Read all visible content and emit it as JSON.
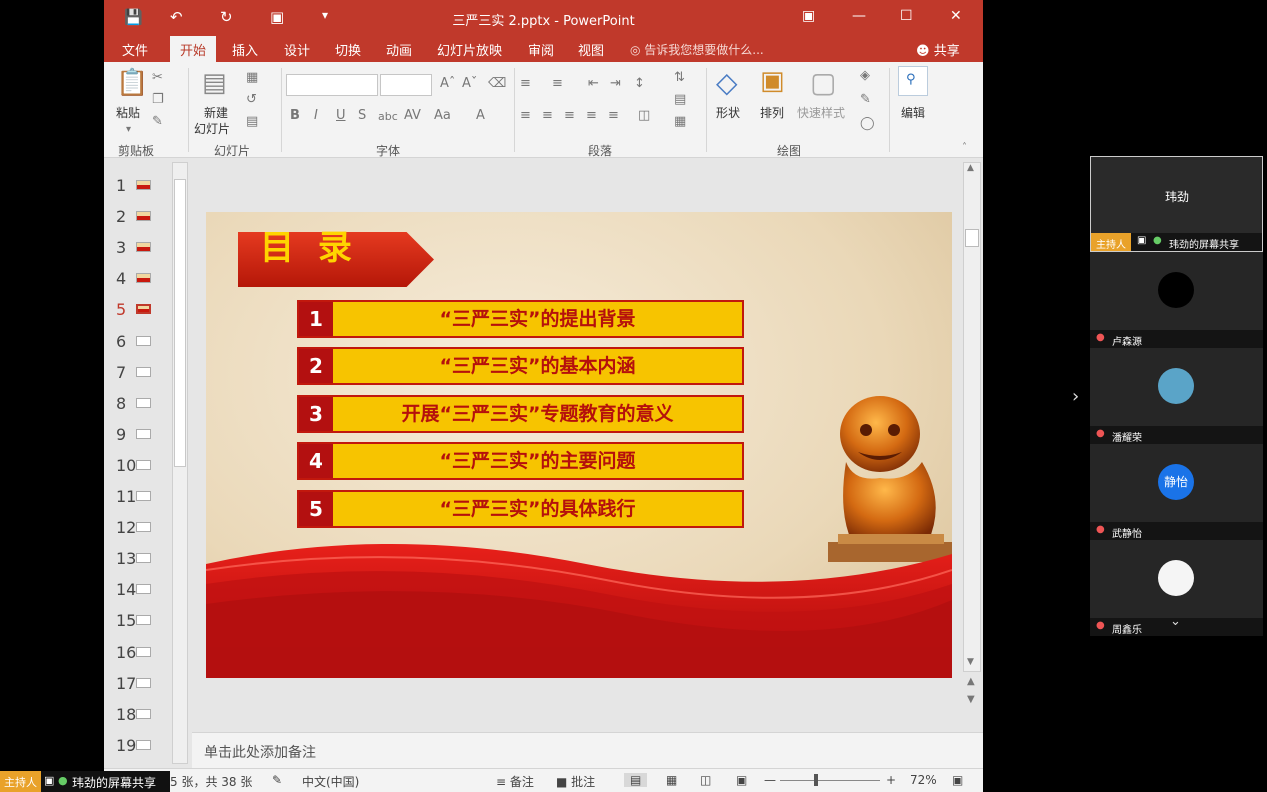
{
  "window": {
    "title": "三严三实 2.pptx - PowerPoint"
  },
  "tabs": [
    "文件",
    "开始",
    "插入",
    "设计",
    "切换",
    "动画",
    "幻灯片放映",
    "审阅",
    "视图"
  ],
  "tell_me": "告诉我您想要做什么...",
  "share": "共享",
  "ribbon": {
    "paste": "粘贴",
    "new_slide": "新建",
    "new_slide2": "幻灯片",
    "shapes": "形状",
    "arrange": "排列",
    "quick_styles": "快速样式",
    "edit": "编辑",
    "groups": {
      "clipboard": "剪贴板",
      "slides": "幻灯片",
      "font": "字体",
      "paragraph": "段落",
      "drawing": "绘图"
    }
  },
  "thumbnails": [
    "1",
    "2",
    "3",
    "4",
    "5",
    "6",
    "7",
    "8",
    "9",
    "10",
    "11",
    "12",
    "13",
    "14",
    "15",
    "16",
    "17",
    "18",
    "19"
  ],
  "current_slide": 5,
  "slide": {
    "title": "目 录",
    "items": [
      {
        "num": "1",
        "text": "“三严三实”的提出背景"
      },
      {
        "num": "2",
        "text": "“三严三实”的基本内涵"
      },
      {
        "num": "3",
        "text": "开展“三严三实”专题教育的意义"
      },
      {
        "num": "4",
        "text": "“三严三实”的主要问题"
      },
      {
        "num": "5",
        "text": "“三严三实”的具体践行"
      }
    ]
  },
  "notes_placeholder": "单击此处添加备注",
  "status": {
    "slide_info": "5 张，共 38 张",
    "language": "中文(中国)",
    "notes": "备注",
    "comments": "批注",
    "zoom": "72%"
  },
  "meeting": {
    "host_label": "主持人",
    "screen_share": "玮劲的屏幕共享",
    "participants": [
      {
        "name": "卢森源",
        "avatar_color": "#000000"
      },
      {
        "name": "潘耀荣",
        "avatar_color": "#5aa4c8"
      },
      {
        "name": "武静怡",
        "avatar_text": "静怡",
        "avatar_color": "#1a73e8"
      },
      {
        "name": "周鑫乐",
        "avatar_color": "#f5f5f5"
      }
    ],
    "host_avatar_text": "玮劲",
    "host_avatar_color": "#1a73e8"
  }
}
